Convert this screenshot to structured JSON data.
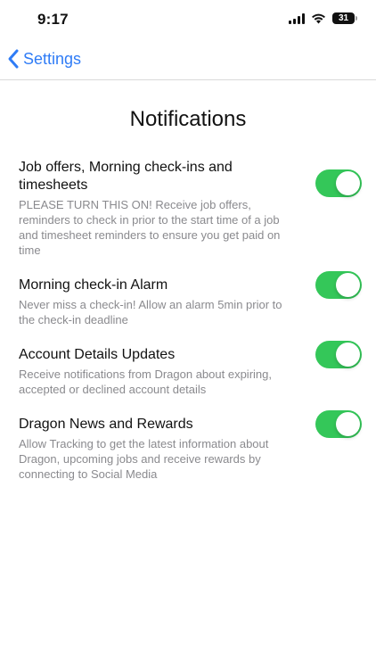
{
  "status_bar": {
    "time": "9:17",
    "battery_level": "31",
    "icons": [
      "signal-icon",
      "wifi-icon",
      "battery-icon"
    ]
  },
  "nav": {
    "back_label": "Settings",
    "back_icon": "chevron-left-icon"
  },
  "page": {
    "title": "Notifications"
  },
  "colors": {
    "accent": "#2f7cf6",
    "toggle_on": "#34c759",
    "secondary_text": "#8a8a8e"
  },
  "settings": [
    {
      "title": "Job offers, Morning check-ins and timesheets",
      "description": "PLEASE TURN THIS ON! Receive job offers, reminders to check in prior to the start time of a job and timesheet reminders to ensure you get paid on time",
      "enabled": true
    },
    {
      "title": "Morning check-in Alarm",
      "description": "Never miss a check-in! Allow an alarm 5min prior to the check-in deadline",
      "enabled": true
    },
    {
      "title": "Account Details Updates",
      "description": "Receive notifications from Dragon about expiring, accepted or declined account details",
      "enabled": true
    },
    {
      "title": "Dragon News and Rewards",
      "description": "Allow Tracking to get the latest information about Dragon, upcoming jobs and receive rewards by connecting to Social Media",
      "enabled": true
    }
  ]
}
